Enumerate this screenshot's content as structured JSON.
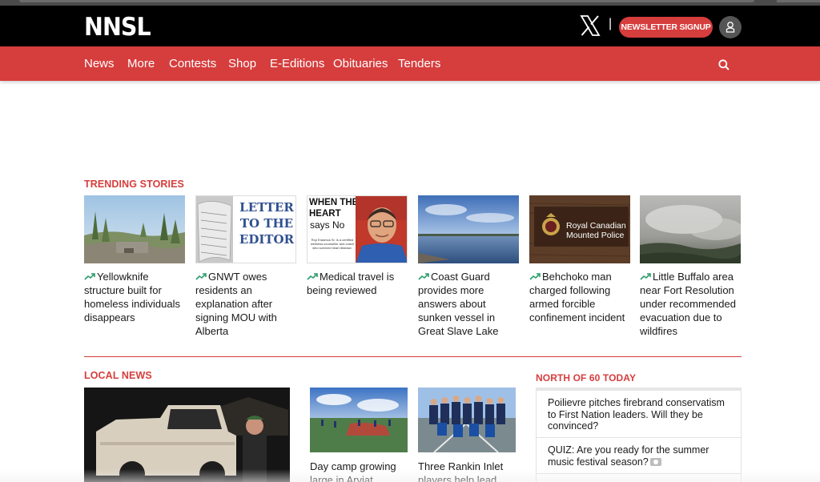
{
  "header": {
    "logo": "NNSL",
    "social_divider": "|",
    "newsletter_label": "NEWSLETTER SIGNUP"
  },
  "nav": {
    "items": [
      "News",
      "More",
      "Contests",
      "Shop",
      "E-Editions",
      "Obituaries",
      "Tenders"
    ]
  },
  "trending": {
    "title": "TRENDING STORIES",
    "stories": [
      {
        "headline": "Yellowknife structure built for homeless individuals disappears",
        "image": "burned-site-photo"
      },
      {
        "headline": "GNWT owes residents an explanation after signing MOU with Alberta",
        "image": "letter-to-editor-graphic"
      },
      {
        "headline": "Medical travel is being reviewed",
        "image": "when-the-heart-says-no-graphic"
      },
      {
        "headline": "Coast Guard provides more answers about sunken vessel in Great Slave Lake",
        "image": "lake-shore-photo"
      },
      {
        "headline": "Behchoko man charged following armed forcible confinement incident",
        "image": "rcmp-sign-photo"
      },
      {
        "headline": "Little Buffalo area near Fort Resolution under recommended evacuation due to wildfires",
        "image": "wildfire-smoke-photo"
      }
    ],
    "graphics": {
      "letter_lines": [
        "LETTER",
        "TO THE",
        "EDITOR"
      ],
      "heart_title": "WHEN THE HEART",
      "heart_sub": "says No",
      "heart_byline": "Roy Erasmus Sr. is a certified wellness counsellor and coach who survived heart disease.",
      "rcmp_line1": "Royal Canadian",
      "rcmp_line2": "Mounted Police"
    }
  },
  "local_news": {
    "title": "LOCAL NEWS",
    "stories": [
      {
        "headline": "Day camp growing large in Arviat",
        "image": "day-camp-field-photo"
      },
      {
        "headline": "Three Rankin Inlet players help lead team",
        "image": "team-group-photo"
      }
    ],
    "lead_image": "truck-night-photo"
  },
  "north_of_60": {
    "title": "NORTH OF 60 TODAY",
    "items": [
      {
        "text": "Poilievre pitches firebrand conservatism to First Nation leaders. Will they be convinced?",
        "has_photo_icon": false
      },
      {
        "text": "QUIZ: Are you ready for the summer music festival season?",
        "has_photo_icon": true
      }
    ]
  },
  "colors": {
    "brand_red": "#d63d3d",
    "header_black": "#000000"
  }
}
